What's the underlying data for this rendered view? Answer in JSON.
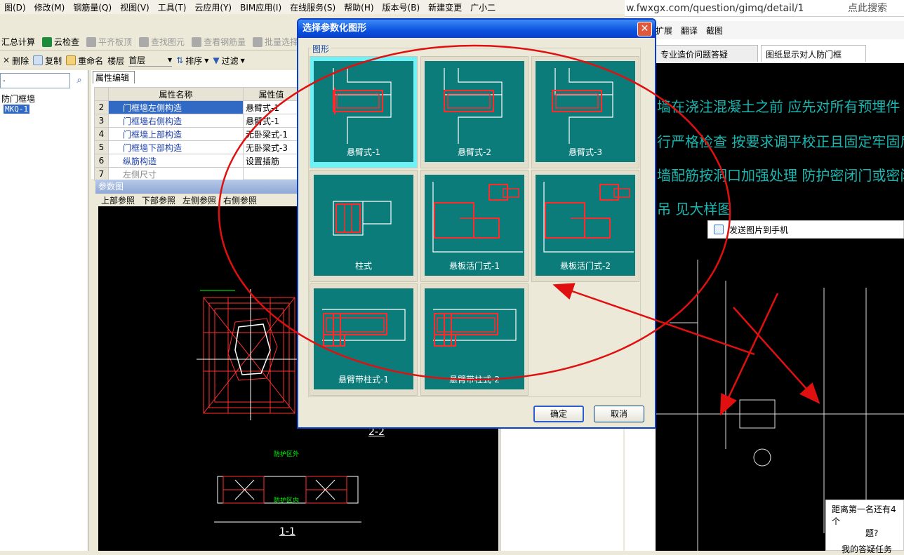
{
  "menu": [
    "图(D)",
    "修改(M)",
    "钢筋量(Q)",
    "视图(V)",
    "工具(T)",
    "云应用(Y)",
    "BIM应用(I)",
    "在线服务(S)",
    "帮助(H)",
    "版本号(B)",
    "新建变更",
    "广小二"
  ],
  "toolbar1": [
    {
      "label": "汇总计算",
      "disabled": false
    },
    {
      "label": "云检查",
      "disabled": false
    },
    {
      "label": "平齐板顶",
      "disabled": true
    },
    {
      "label": "查找图元",
      "disabled": true
    },
    {
      "label": "查看钢筋量",
      "disabled": true
    },
    {
      "label": "批量选择",
      "disabled": true
    }
  ],
  "toolbar2": {
    "delete": "删除",
    "copy": "复制",
    "rename": "重命名",
    "floor_label": "楼层",
    "floor_value": "首层",
    "sort": "排序",
    "filter": "过滤"
  },
  "tree": {
    "search_value": ".",
    "node": "防门框墙",
    "child": "MKQ-1"
  },
  "props": {
    "tab": "属性编辑",
    "headers": [
      "属性名称",
      "属性值"
    ],
    "rows": [
      {
        "no": "2",
        "name": "门框墙左侧构造",
        "value": "悬臂式-1",
        "selected": true
      },
      {
        "no": "3",
        "name": "门框墙右侧构造",
        "value": "悬臂式-1",
        "selected": false
      },
      {
        "no": "4",
        "name": "门框墙上部构造",
        "value": "无卧梁式-1",
        "selected": false
      },
      {
        "no": "5",
        "name": "门框墙下部构造",
        "value": "无卧梁式-3",
        "selected": false
      },
      {
        "no": "6",
        "name": "纵筋构造",
        "value": "设置插筋",
        "selected": false
      },
      {
        "no": "7",
        "name": "左侧尺寸",
        "value": "",
        "selected": false
      }
    ]
  },
  "reference": {
    "title": "参数图",
    "nav": [
      "上部参照",
      "下部参照",
      "左侧参照",
      "右侧参照"
    ],
    "labels": {
      "section_22": "2-2",
      "section_11": "1-1",
      "zone_outer": "防护区外",
      "zone_inner": "防护区内"
    }
  },
  "browser": {
    "url": "w.fwxgx.com/question/gimq/detail/1",
    "search_hint": "点此搜索",
    "tools": [
      "扩展",
      "翻译",
      "截图"
    ],
    "tabs": [
      "专业造价问题答疑",
      "图纸显示对人防门框"
    ],
    "send_to_phone": "发送图片到手机",
    "cad_text_1": "墙在浇注混凝土之前 应先对所有预埋件（角钢门",
    "cad_text_2": "行严格检查 按要求调平校正且固定牢固后 方可浇",
    "cad_text_3": "墙配筋按洞口加强处理 防护密闭门或密闭门 Φ2",
    "cad_text_4": "吊 见大样图",
    "notice_1": "距离第一名还有4个",
    "notice_2": "题?",
    "notice_3": "我的答疑任务"
  },
  "dialog": {
    "title": "选择参数化图形",
    "group_label": "图形",
    "ok": "确定",
    "cancel": "取消",
    "shapes": [
      {
        "label": "悬臂式-1",
        "selected": true
      },
      {
        "label": "悬臂式-2",
        "selected": false
      },
      {
        "label": "悬臂式-3",
        "selected": false
      },
      {
        "label": "柱式",
        "selected": false
      },
      {
        "label": "悬板活门式-1",
        "selected": false
      },
      {
        "label": "悬板活门式-2",
        "selected": false
      },
      {
        "label": "悬臂带柱式-1",
        "selected": false
      },
      {
        "label": "悬臂带柱式-2",
        "selected": false
      }
    ]
  },
  "colors": {
    "thumb_bg": "#0b7c7a",
    "selected_cell": "#6ff1f7",
    "annotation_red": "#e01010",
    "title_blue": "#0a52e0"
  }
}
